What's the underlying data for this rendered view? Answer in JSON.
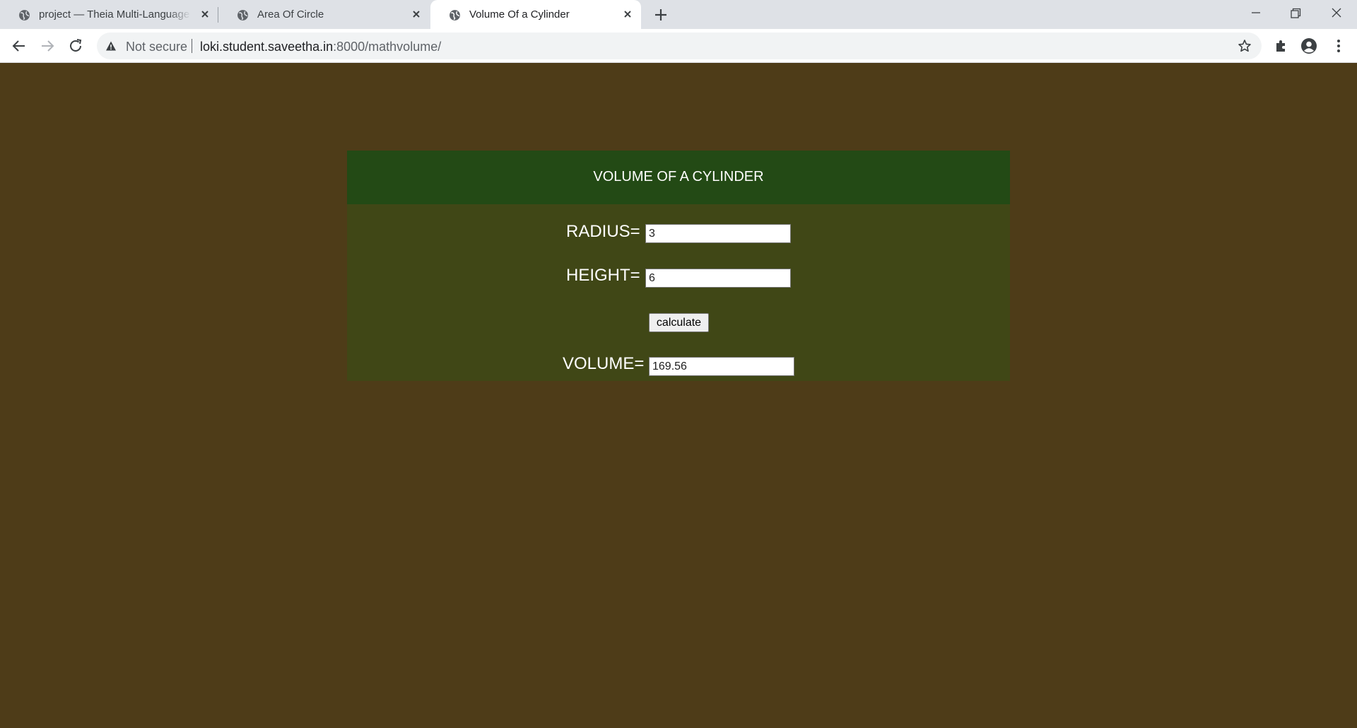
{
  "browser": {
    "tabs": [
      {
        "title": "project — Theia Multi-Language",
        "active": false
      },
      {
        "title": "Area Of Circle",
        "active": false
      },
      {
        "title": "Volume Of a Cylinder",
        "active": true
      }
    ],
    "security_label": "Not secure",
    "url_host": "loki.student.saveetha.in",
    "url_rest": ":8000/mathvolume/"
  },
  "page": {
    "title": "VOLUME OF A CYLINDER",
    "radius_label": "RADIUS=",
    "radius_value": "3",
    "height_label": "HEIGHT=",
    "height_value": "6",
    "calculate_label": "calculate",
    "volume_label": "VOLUME=",
    "volume_value": "169.56"
  },
  "colors": {
    "page_background": "#4e3c18",
    "panel_header": "#234a15",
    "panel_body": "#404716",
    "text": "#ffffff"
  },
  "icons": [
    "globe-icon",
    "close-icon",
    "plus-icon",
    "minimize-icon",
    "restore-icon",
    "back-icon",
    "forward-icon",
    "reload-icon",
    "warning-icon",
    "star-icon",
    "extensions-icon",
    "profile-icon",
    "menu-icon"
  ]
}
